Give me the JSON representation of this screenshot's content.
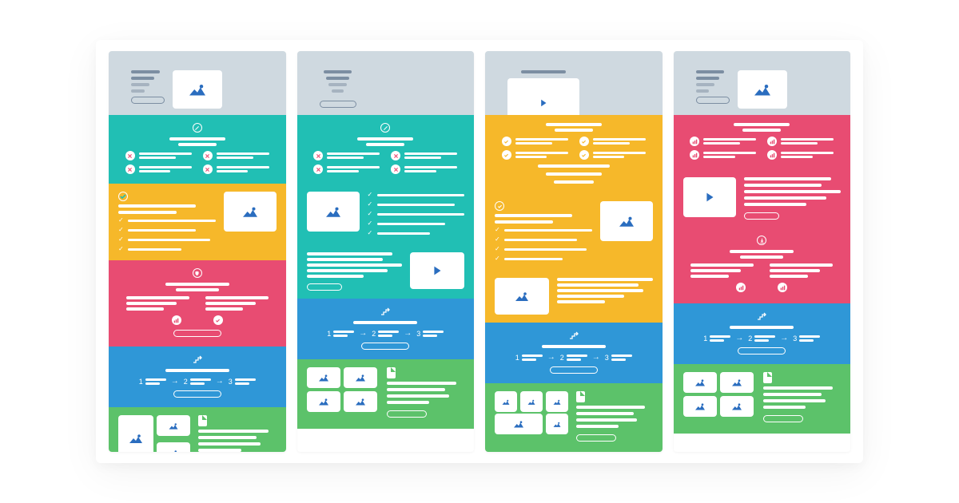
{
  "description": "Four side-by-side email / landing-page wireframe layout variants, each column is a vertical stack of colored section blocks (hero, problem, benefits, differentiator, steps, social-proof).",
  "palette": {
    "grey": "#cfd9e0",
    "teal": "#21bfb4",
    "yellow": "#f6b82a",
    "pink": "#e84c72",
    "blue": "#2f97d7",
    "green": "#5cc26a",
    "ink": "#7c8ea2",
    "brand_blue": "#2a6dbf"
  },
  "columns": [
    {
      "id": 1,
      "sections": [
        {
          "kind": "hero",
          "color": "grey",
          "layout": "text-left-image-right",
          "media": "image"
        },
        {
          "kind": "problem",
          "color": "teal",
          "top_icon": "no-entry",
          "item_icon": "x",
          "columns": 2
        },
        {
          "kind": "benefits",
          "color": "yellow",
          "layout": "list-left-image-right",
          "media": "image",
          "list_icon": "check"
        },
        {
          "kind": "differentiator",
          "color": "pink",
          "badges": 2,
          "cta": true
        },
        {
          "kind": "steps",
          "color": "blue",
          "step_count": 3,
          "cta": true
        },
        {
          "kind": "social_proof",
          "color": "green",
          "gallery": "1-large-2-small",
          "cta": true
        }
      ]
    },
    {
      "id": 2,
      "sections": [
        {
          "kind": "hero",
          "color": "grey",
          "layout": "centered-text",
          "media": null
        },
        {
          "kind": "problem",
          "color": "teal",
          "top_icon": "no-entry",
          "item_icon": "x",
          "columns": 2
        },
        {
          "kind": "benefits",
          "color": "teal",
          "layout": "image-left-list-right",
          "media": "image",
          "list_icon": "check"
        },
        {
          "kind": "media_row",
          "color": "teal",
          "layout": "text-left-video-right",
          "media": "video",
          "cta": true
        },
        {
          "kind": "steps",
          "color": "blue",
          "step_count": 3,
          "cta": true
        },
        {
          "kind": "social_proof",
          "color": "green",
          "gallery": "2x2",
          "cta": true
        }
      ]
    },
    {
      "id": 3,
      "sections": [
        {
          "kind": "hero",
          "color": "grey",
          "layout": "centered-video",
          "media": "video"
        },
        {
          "kind": "problem",
          "color": "yellow",
          "top_icon": "check-circle",
          "item_icon": "check",
          "columns": 2
        },
        {
          "kind": "benefits",
          "color": "yellow",
          "layout": "list-left-image-right",
          "media": "image",
          "list_icon": "check"
        },
        {
          "kind": "media_row",
          "color": "yellow",
          "layout": "image-left-text-right",
          "media": "image"
        },
        {
          "kind": "steps",
          "color": "blue",
          "step_count": 3,
          "cta": true
        },
        {
          "kind": "social_proof",
          "color": "green",
          "gallery": "3-top-1-wide",
          "cta": true
        }
      ]
    },
    {
      "id": 4,
      "sections": [
        {
          "kind": "hero",
          "color": "grey",
          "layout": "text-left-image-right",
          "media": "image"
        },
        {
          "kind": "problem",
          "color": "pink",
          "top_icon": null,
          "item_icon": "chart",
          "columns": 2
        },
        {
          "kind": "benefits",
          "color": "pink",
          "layout": "video-left-text-right",
          "media": "video",
          "cta": true
        },
        {
          "kind": "differentiator",
          "color": "pink",
          "badges": 2,
          "cta": false,
          "compact": true
        },
        {
          "kind": "steps",
          "color": "blue",
          "step_count": 3,
          "cta": true
        },
        {
          "kind": "social_proof",
          "color": "green",
          "gallery": "2x2",
          "cta": true
        }
      ]
    }
  ],
  "steps_labels": [
    "1",
    "2",
    "3"
  ]
}
